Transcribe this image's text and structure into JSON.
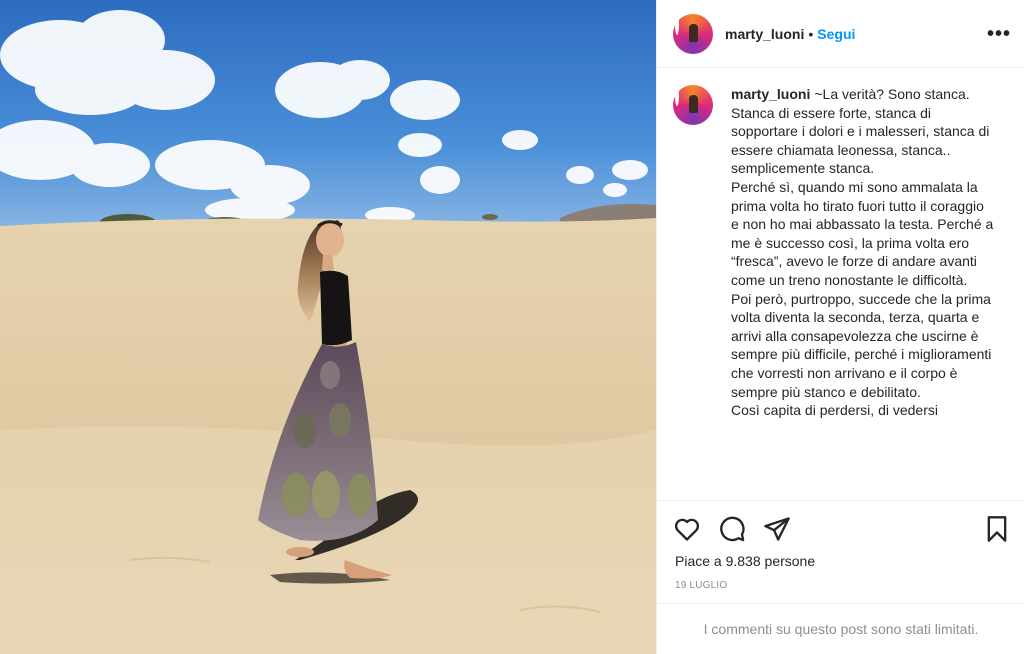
{
  "post": {
    "username": "marty_luoni",
    "follow_label": "Segui",
    "separator": "•",
    "more_label": "•••",
    "photo_alt": "",
    "caption": {
      "username": "marty_luoni",
      "text": "~La verità? Sono stanca.\nStanca di essere forte, stanca di sopportare i dolori e i malesseri, stanca di essere chiamata leonessa, stanca.. semplicemente stanca.\nPerché sì, quando mi sono ammalata la prima volta ho tirato fuori tutto il coraggio e non ho mai abbassato la testa. Perché a me è successo così, la prima volta ero “fresca”, avevo le forze di andare avanti come un treno nonostante le difficoltà.\nPoi però, purtroppo, succede che la prima volta diventa la seconda, terza, quarta e arrivi alla consapevolezza che uscirne è sempre più difficile, perché i miglioramenti che vorresti non arrivano e il corpo è sempre più stanco e debilitato.\nCosì capita di perdersi, di vedersi"
    },
    "actions": {
      "like_icon": "heart-icon",
      "comment_icon": "comment-icon",
      "share_icon": "share-icon",
      "save_icon": "bookmark-icon"
    },
    "likes": {
      "prefix": "Piace a",
      "count": "9.838",
      "suffix": "persone"
    },
    "date": "19 LUGLIO",
    "comments_limited": "I commenti su questo post sono stati limitati."
  },
  "colors": {
    "accent": "#0095f6",
    "text": "#262626",
    "muted": "#8e8e8e",
    "border": "#efefef"
  }
}
